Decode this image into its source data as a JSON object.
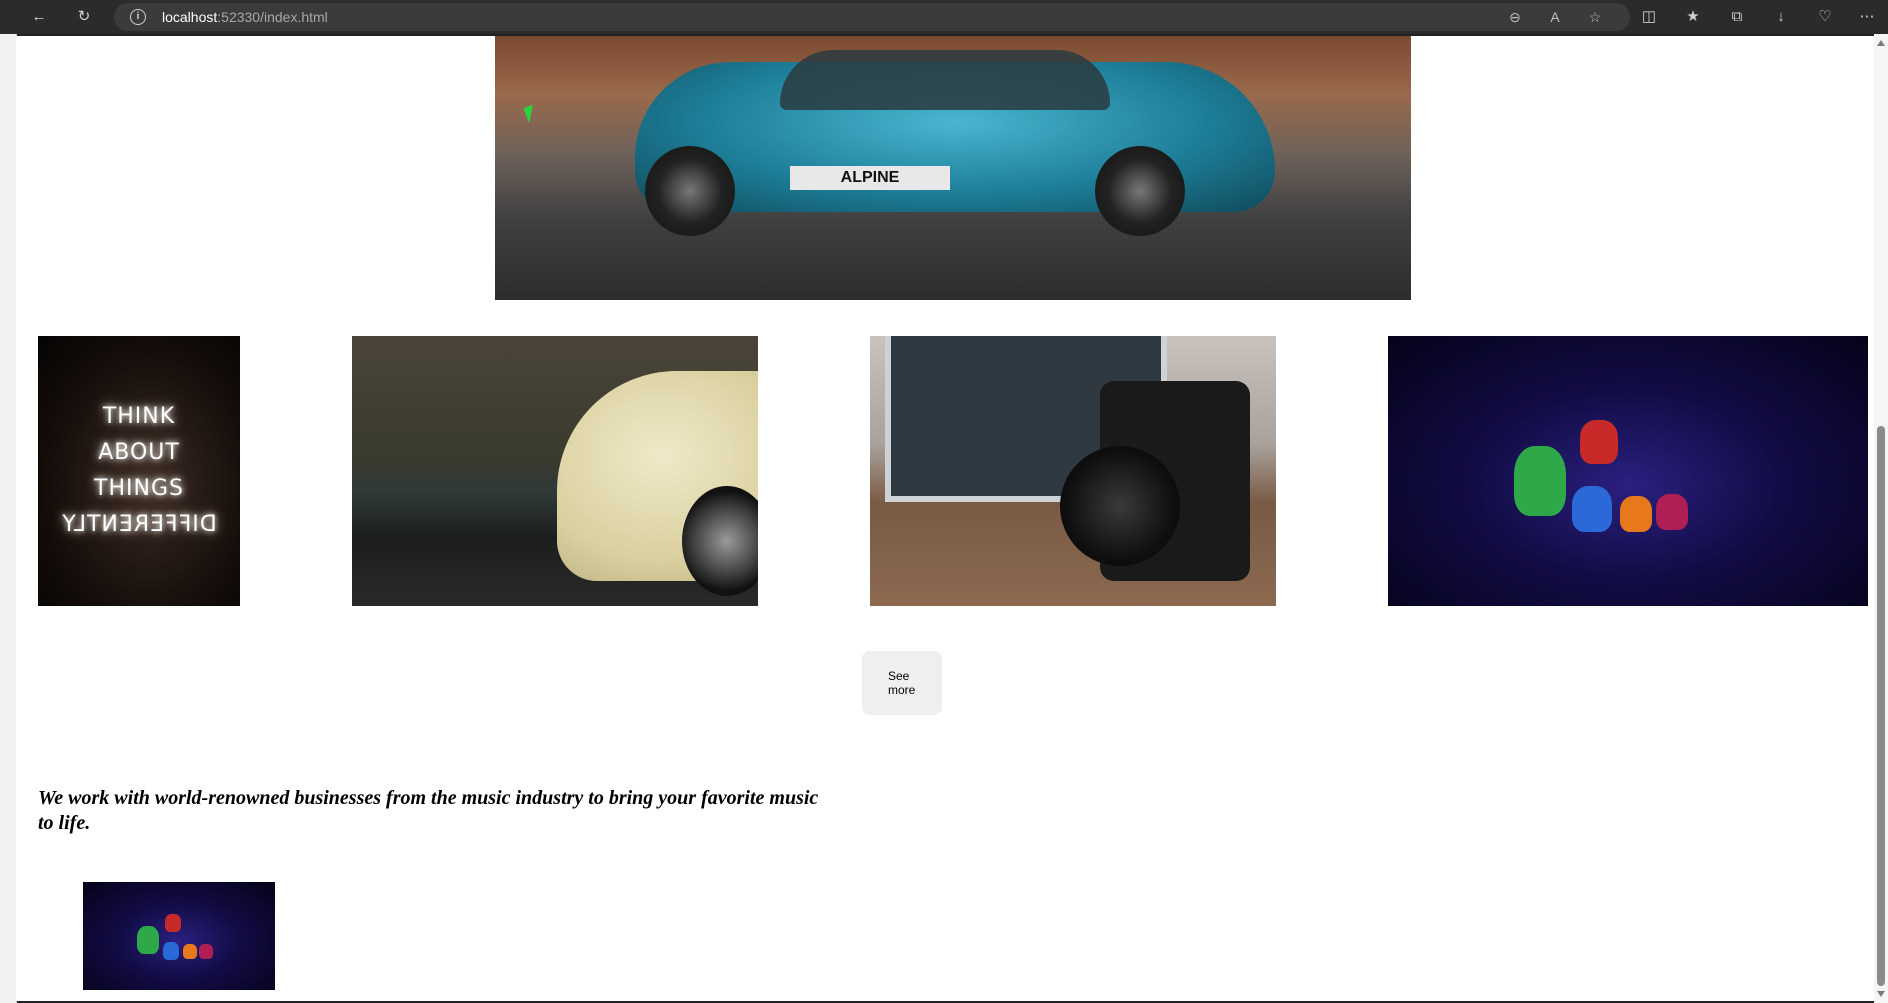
{
  "browser": {
    "url_host": "localhost",
    "url_rest": ":52330/index.html"
  },
  "hero": {
    "plate_text": "ALPINE"
  },
  "gallery": {
    "neon_lines": [
      "THINK",
      "ABOUT",
      "THINGS",
      "DIFFERENTLY"
    ]
  },
  "see_more_label": "See more",
  "tagline": "We work with world-renowned businesses from the music industry to bring your favorite music to life.",
  "colors": {
    "background": "#ffffff",
    "button_bg": "#efefef",
    "toolbar_bg": "#2b2b2b"
  }
}
